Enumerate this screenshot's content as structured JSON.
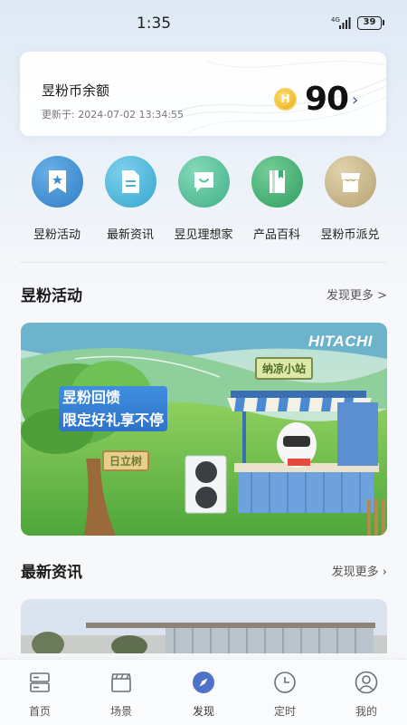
{
  "status_bar": {
    "time": "1:35",
    "network": "4G",
    "battery": "39"
  },
  "balance": {
    "title": "昱粉币余额",
    "updated": "更新于:  2024-07-02 13:34:55",
    "amount": "90",
    "coin_letter": "H",
    "chevron": "›"
  },
  "quick_menu": [
    {
      "label": "昱粉活动",
      "icon": "star-bookmark-icon",
      "color": "#3b8fd6"
    },
    {
      "label": "最新资讯",
      "icon": "document-icon",
      "color": "#4ab3d8"
    },
    {
      "label": "昱见理想家",
      "icon": "chat-smile-icon",
      "color": "#4fbf9a"
    },
    {
      "label": "产品百科",
      "icon": "book-icon",
      "color": "#3fae74"
    },
    {
      "label": "昱粉币派兑",
      "icon": "shop-icon",
      "color": "#c9b78a"
    }
  ],
  "sections": {
    "activities": {
      "title": "昱粉活动",
      "more": "发现更多 >"
    },
    "news": {
      "title": "最新资讯",
      "more": "发现更多 ›"
    }
  },
  "banner": {
    "brand": "HITACHI",
    "headline_line1": "昱粉回馈",
    "headline_line2": "限定好礼享不停",
    "stand_sign": "纳凉小站",
    "tree_sign": "日立树"
  },
  "tabs": [
    {
      "label": "首页",
      "icon": "home-device-icon"
    },
    {
      "label": "场景",
      "icon": "clapperboard-icon"
    },
    {
      "label": "发现",
      "icon": "compass-icon",
      "active": true
    },
    {
      "label": "定时",
      "icon": "clock-icon"
    },
    {
      "label": "我的",
      "icon": "user-icon"
    }
  ],
  "colors": {
    "accent": "#3b78d8",
    "discover_active": "#4d72c8"
  }
}
